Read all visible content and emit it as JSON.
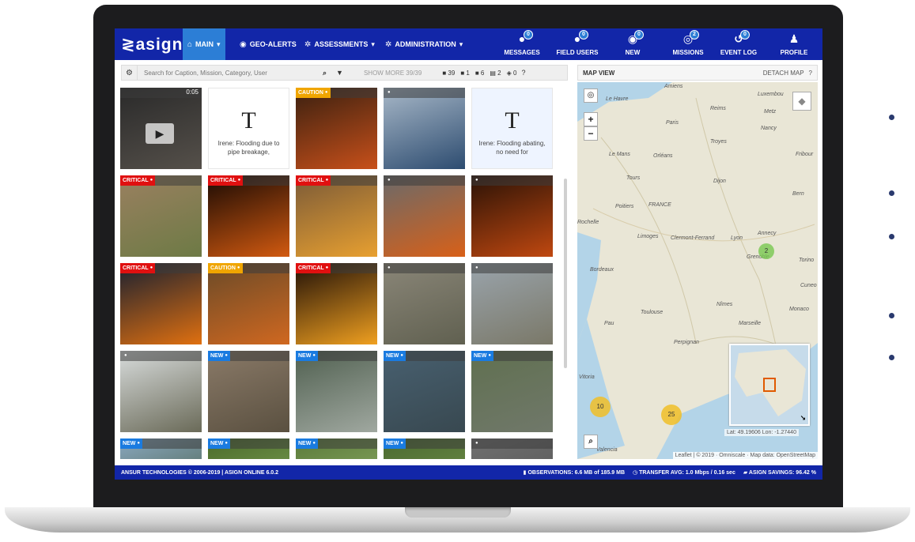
{
  "brand": {
    "logo": "≷asign"
  },
  "nav": {
    "main": "MAIN",
    "geo_alerts": "GEO-ALERTS",
    "assessments": "ASSESSMENTS",
    "administration": "ADMINISTRATION"
  },
  "right_nav": [
    {
      "label": "MESSAGES",
      "badge": "0",
      "icon": "chat-icon"
    },
    {
      "label": "FIELD USERS",
      "badge": "0",
      "icon": "users-icon"
    },
    {
      "label": "NEW",
      "badge": "0",
      "icon": "eye-icon"
    },
    {
      "label": "MISSIONS",
      "badge": "2",
      "icon": "target-icon"
    },
    {
      "label": "EVENT LOG",
      "badge": "0",
      "icon": "history-icon"
    },
    {
      "label": "PROFILE",
      "badge": "",
      "icon": "user-icon"
    }
  ],
  "toolbar": {
    "search_placeholder": "Search for Caption, Mission, Category, User",
    "show_more": "SHOW MORE 39/39",
    "counts": {
      "photos": "39",
      "videos": "1",
      "messages": "6",
      "forms": "2",
      "locations": "0"
    }
  },
  "tiles": [
    {
      "type": "video",
      "duration": "0:05"
    },
    {
      "type": "text",
      "caption": "Irene: Flooding due to pipe breakage,",
      "variant": "white"
    },
    {
      "type": "photo",
      "tag": "CAUTION"
    },
    {
      "type": "photo",
      "tag": ""
    },
    {
      "type": "text",
      "caption": "Irene: Flooding abating, no need for",
      "variant": "blue"
    },
    {
      "type": "photo",
      "tag": "CRITICAL"
    },
    {
      "type": "photo",
      "tag": "CRITICAL"
    },
    {
      "type": "photo",
      "tag": "CRITICAL"
    },
    {
      "type": "photo",
      "tag": ""
    },
    {
      "type": "photo",
      "tag": ""
    },
    {
      "type": "photo",
      "tag": "CRITICAL"
    },
    {
      "type": "photo",
      "tag": "CAUTION"
    },
    {
      "type": "photo",
      "tag": "CRITICAL"
    },
    {
      "type": "photo",
      "tag": ""
    },
    {
      "type": "photo",
      "tag": ""
    },
    {
      "type": "photo",
      "tag": ""
    },
    {
      "type": "photo",
      "tag": "NEW"
    },
    {
      "type": "photo",
      "tag": "NEW"
    },
    {
      "type": "photo",
      "tag": "NEW"
    },
    {
      "type": "photo",
      "tag": "NEW"
    },
    {
      "type": "photo",
      "tag": "NEW"
    },
    {
      "type": "photo",
      "tag": "NEW"
    },
    {
      "type": "photo",
      "tag": "NEW"
    },
    {
      "type": "photo",
      "tag": "NEW"
    },
    {
      "type": "photo",
      "tag": ""
    }
  ],
  "map": {
    "title": "MAP VIEW",
    "detach": "DETACH MAP",
    "clusters": [
      "2",
      "10",
      "25"
    ],
    "latlon": "Lat: 49.19606 Lon: -1.27440",
    "attribution": "Leaflet | © 2019 · Omniscale · Map data: OpenStreetMap",
    "cities": [
      "Amiens",
      "Luxembou",
      "Le Havre",
      "Reims",
      "Metz",
      "Paris",
      "Nancy",
      "Troyes",
      "Le Mans",
      "Orléans",
      "Fribour",
      "Tours",
      "Dijon",
      "Bern",
      "Poitiers",
      "FRANCE",
      "Limoges",
      "Clermont-Ferrand",
      "Lyon",
      "Annecy",
      "Bordeaux",
      "Grenoble",
      "Torino",
      "Nîmes",
      "Monaco",
      "Toulouse",
      "Marseille",
      "Pau",
      "Perpignan",
      "Cuneo",
      "Rochelle",
      "Vitoria",
      "Valencia"
    ]
  },
  "footer": {
    "left": "ANSUR TECHNOLOGIES © 2006-2019 | ASIGN ONLINE 6.0.2",
    "observations": "OBSERVATIONS: 6.6 MB of 185.9 MB",
    "transfer": "TRANSFER AVG: 1.0 Mbps / 0.16 sec",
    "savings": "ASIGN SAVINGS: 96.42 %"
  }
}
